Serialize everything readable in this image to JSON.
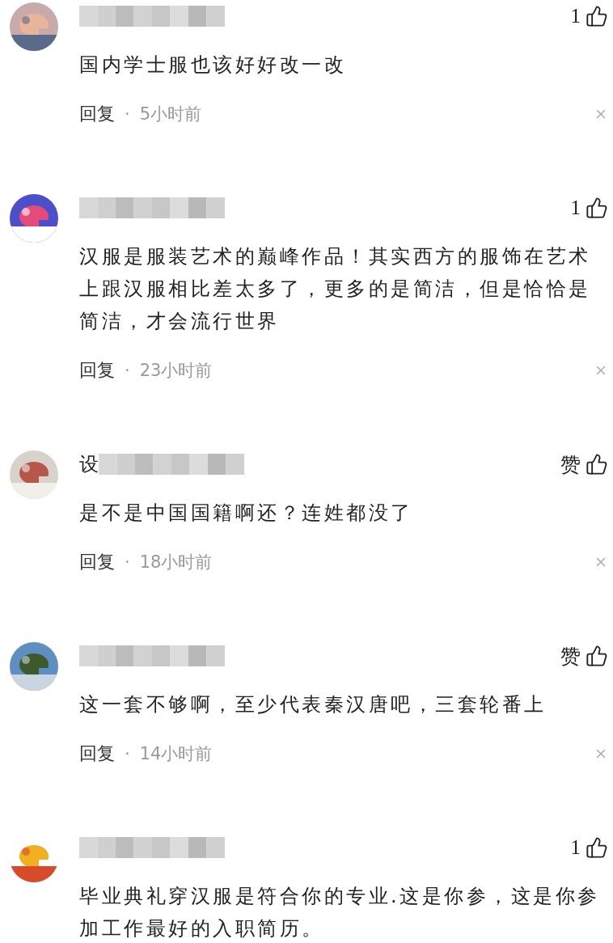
{
  "comments": [
    {
      "likes": "1",
      "text": "国内学士服也该好好改一改",
      "reply": "回复",
      "dot": "·",
      "time": "5小时前"
    },
    {
      "likes": "1",
      "text": "汉服是服装艺术的巅峰作品！其实西方的服饰在艺术上跟汉服相比差太多了，更多的是简洁，但是恰恰是简洁，才会流行世界",
      "reply": "回复",
      "dot": "·",
      "time": "23小时前"
    },
    {
      "name": "设",
      "likes": "赞",
      "text": "是不是中国国籍啊还？连姓都没了",
      "reply": "回复",
      "dot": "·",
      "time": "18小时前"
    },
    {
      "likes": "赞",
      "text": "这一套不够啊，至少代表秦汉唐吧，三套轮番上",
      "reply": "回复",
      "dot": "·",
      "time": "14小时前"
    },
    {
      "likes": "1",
      "text": "毕业典礼穿汉服是符合你的专业.这是你参，这是你参加工作最好的入职简历。"
    }
  ]
}
